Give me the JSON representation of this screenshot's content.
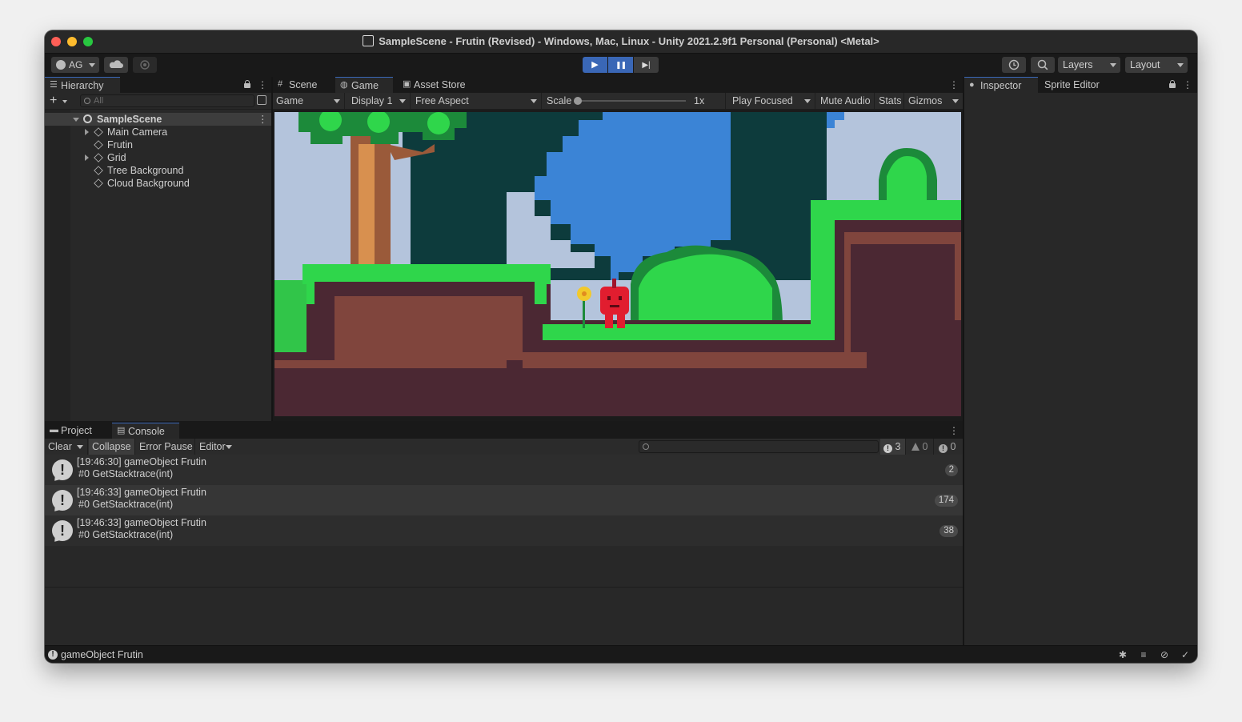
{
  "window": {
    "title": "SampleScene - Frutin (Revised) - Windows, Mac, Linux - Unity 2021.2.9f1 Personal (Personal) <Metal>"
  },
  "toolbar": {
    "account_label": "AG",
    "layers_label": "Layers",
    "layout_label": "Layout",
    "play_icon": "▶",
    "pause_icon": "❚❚",
    "step_icon": "▶|"
  },
  "hierarchy": {
    "tab_label": "Hierarchy",
    "add_label": "+",
    "search_placeholder": "All",
    "scene_name": "SampleScene",
    "items": [
      {
        "label": "Main Camera",
        "expandable": true
      },
      {
        "label": "Frutin",
        "expandable": false
      },
      {
        "label": "Grid",
        "expandable": true
      },
      {
        "label": "Tree Background",
        "expandable": false
      },
      {
        "label": "Cloud Background",
        "expandable": false
      }
    ]
  },
  "center_tabs": {
    "scene": "Scene",
    "game": "Game",
    "asset_store": "Asset Store"
  },
  "game_toolbar": {
    "view_mode": "Game",
    "display": "Display 1",
    "aspect": "Free Aspect",
    "scale_label": "Scale",
    "scale_value": "1x",
    "play_focused": "Play Focused",
    "mute_audio": "Mute Audio",
    "stats": "Stats",
    "gizmos": "Gizmos"
  },
  "right_tabs": {
    "inspector": "Inspector",
    "sprite_editor": "Sprite Editor"
  },
  "bottom_tabs": {
    "project": "Project",
    "console": "Console"
  },
  "console_toolbar": {
    "clear": "Clear",
    "collapse": "Collapse",
    "error_pause": "Error Pause",
    "editor": "Editor",
    "log_count": "3",
    "warning_count": "0",
    "error_count": "0"
  },
  "console": {
    "entries": [
      {
        "message": "[19:46:30] gameObject Frutin",
        "trace": "#0 GetStacktrace(int)",
        "count": "2"
      },
      {
        "message": "[19:46:33] gameObject Frutin",
        "trace": "#0 GetStacktrace(int)",
        "count": "174"
      },
      {
        "message": "[19:46:33] gameObject Frutin",
        "trace": "#0 GetStacktrace(int)",
        "count": "38"
      }
    ]
  },
  "statusbar": {
    "message": "gameObject Frutin"
  },
  "colors": {
    "accent": "#3a67b6",
    "sky": "#b4c4dc",
    "sky_blue": "#3b84d6",
    "dark_teal": "#0d3b3c",
    "grass": "#2fd64b",
    "dirt": "#4b2833",
    "dirt_edge": "#8a4a3f",
    "character": "#e11d2f"
  }
}
